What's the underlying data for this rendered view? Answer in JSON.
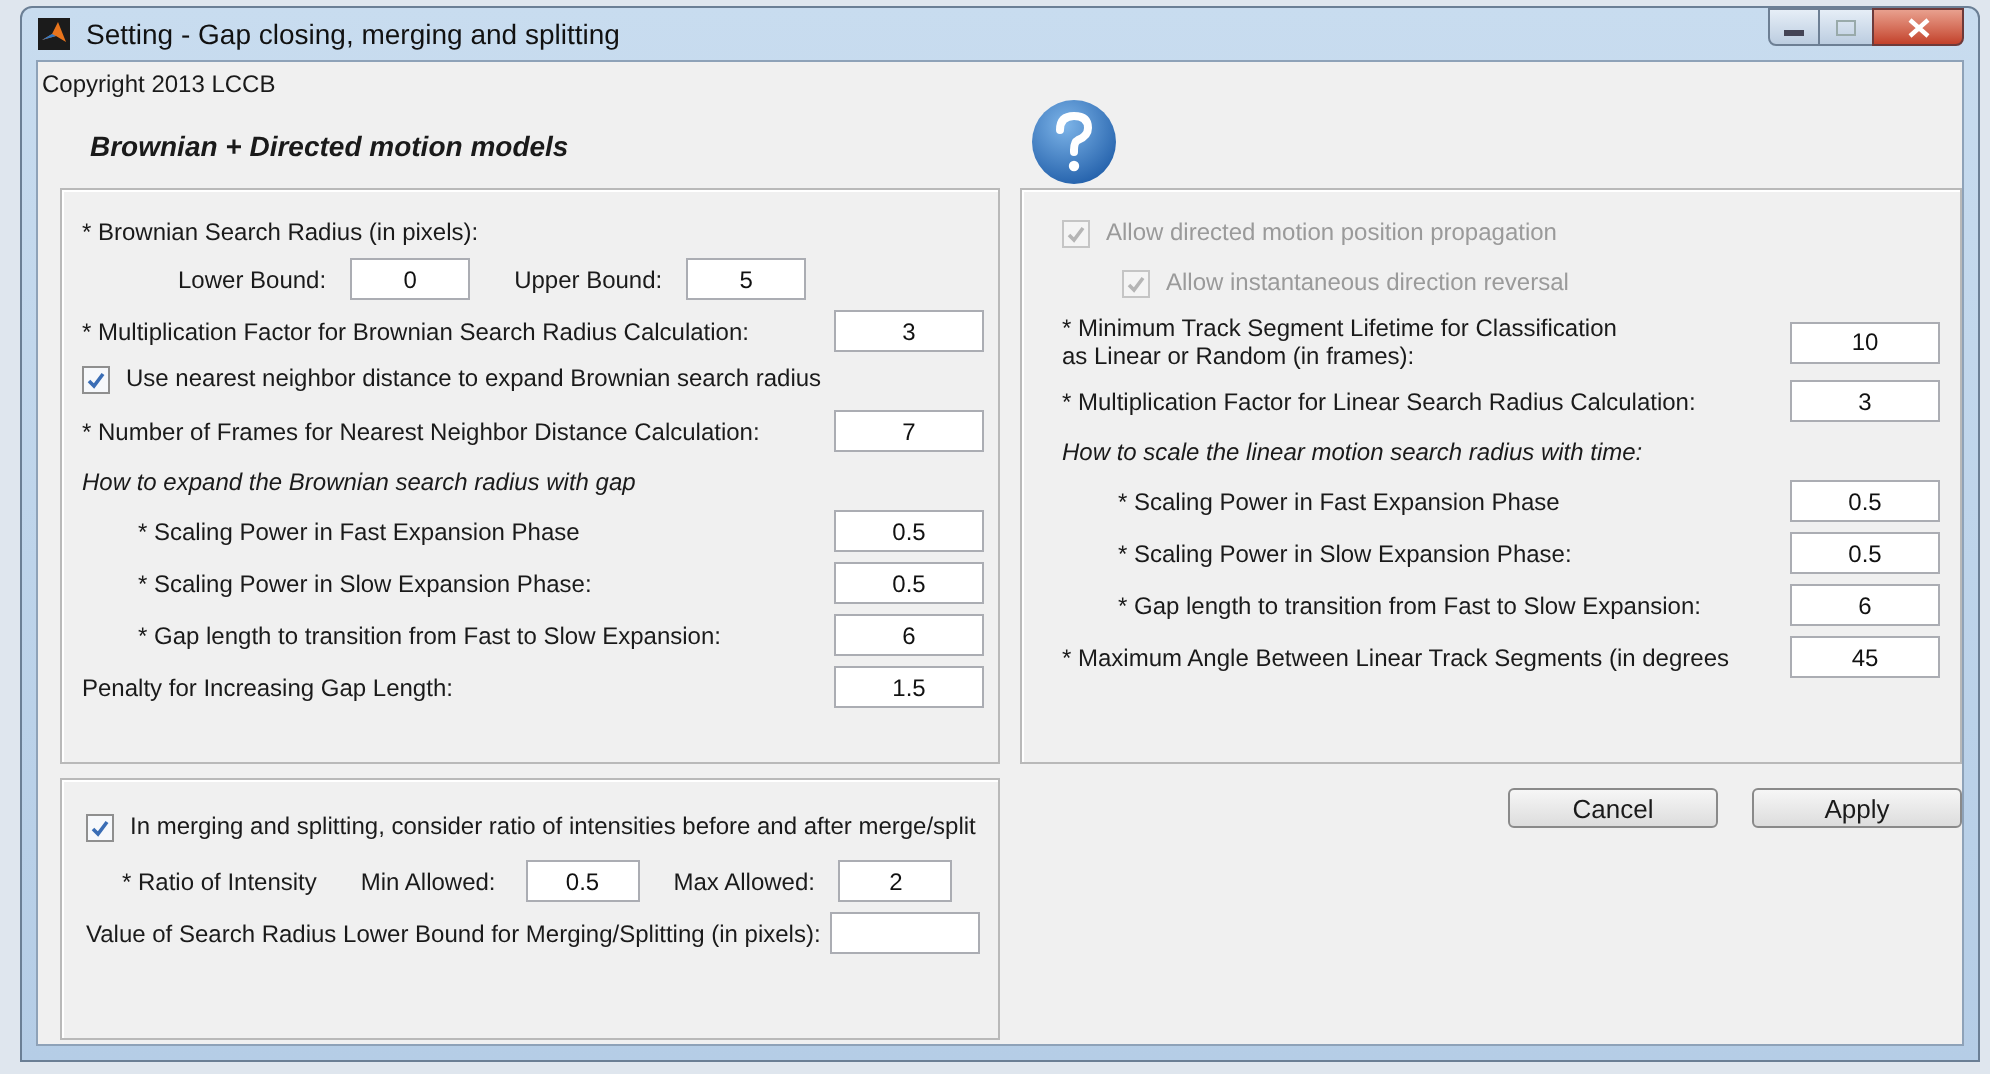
{
  "window": {
    "title": "Setting - Gap closing, merging and splitting"
  },
  "copyright": "Copyright 2013 LCCB",
  "heading": "Brownian + Directed motion models",
  "brownian_panel": {
    "rows": [
      {
        "kind": "text",
        "label": "* Brownian Search Radius (in pixels):"
      },
      {
        "kind": "bounds",
        "lower_label": "Lower Bound:",
        "lower_value": "0",
        "upper_label": "Upper Bound:",
        "upper_value": "5"
      },
      {
        "kind": "field",
        "label": "* Multiplication Factor for Brownian Search Radius Calculation:",
        "value": "3"
      },
      {
        "kind": "checkbox",
        "label": "Use nearest neighbor distance to expand Brownian search radius",
        "checked": true,
        "disabled": false
      },
      {
        "kind": "field",
        "label": "* Number of Frames for Nearest Neighbor Distance Calculation:",
        "value": "7"
      },
      {
        "kind": "note",
        "label": "How to expand the Brownian search radius with gap",
        "children": [
          {
            "kind": "field",
            "label": "* Scaling Power in Fast Expansion Phase",
            "value": "0.5"
          },
          {
            "kind": "field",
            "label": "* Scaling Power in Slow Expansion Phase:",
            "value": "0.5"
          },
          {
            "kind": "field",
            "label": "* Gap length to transition from Fast to Slow Expansion:",
            "value": "6"
          }
        ]
      },
      {
        "kind": "field",
        "label": "Penalty for Increasing Gap Length:",
        "value": "1.5"
      }
    ]
  },
  "merge_panel": {
    "rows": [
      {
        "kind": "checkbox",
        "label": "In merging and splitting, consider ratio of intensities before and after merge/split",
        "checked": true,
        "disabled": false
      },
      {
        "kind": "ratio",
        "label": "* Ratio of Intensity",
        "min_label": "Min Allowed:",
        "min_value": "0.5",
        "max_label": "Max Allowed:",
        "max_value": "2"
      },
      {
        "kind": "field",
        "label": "Value of Search Radius Lower Bound for Merging/Splitting (in pixels):"
      }
    ]
  },
  "directed_panel": {
    "rows": [
      {
        "kind": "checkbox",
        "label": "Allow directed motion position propagation",
        "checked": true,
        "disabled": true,
        "children": [
          {
            "kind": "checkbox",
            "label": "Allow instantaneous direction reversal",
            "checked": true,
            "disabled": true
          }
        ]
      },
      {
        "kind": "field",
        "label": "* Minimum Track Segment Lifetime for Classification\nas Linear or Random (in frames):",
        "value": "10"
      },
      {
        "kind": "field",
        "label": "* Multiplication Factor for Linear Search Radius Calculation:",
        "value": "3"
      },
      {
        "kind": "note",
        "label": "How to scale the linear motion search radius with time:",
        "children": [
          {
            "kind": "field",
            "label": "* Scaling Power in Fast Expansion Phase",
            "value": "0.5"
          },
          {
            "kind": "field",
            "label": "* Scaling Power in Slow Expansion Phase:",
            "value": "0.5"
          },
          {
            "kind": "field",
            "label": "* Gap length to transition from Fast to Slow Expansion:",
            "value": "6"
          }
        ]
      },
      {
        "kind": "field",
        "label": "* Maximum Angle Between Linear Track Segments (in degrees",
        "value": "45"
      }
    ]
  },
  "buttons": [
    "Cancel",
    "Apply"
  ]
}
